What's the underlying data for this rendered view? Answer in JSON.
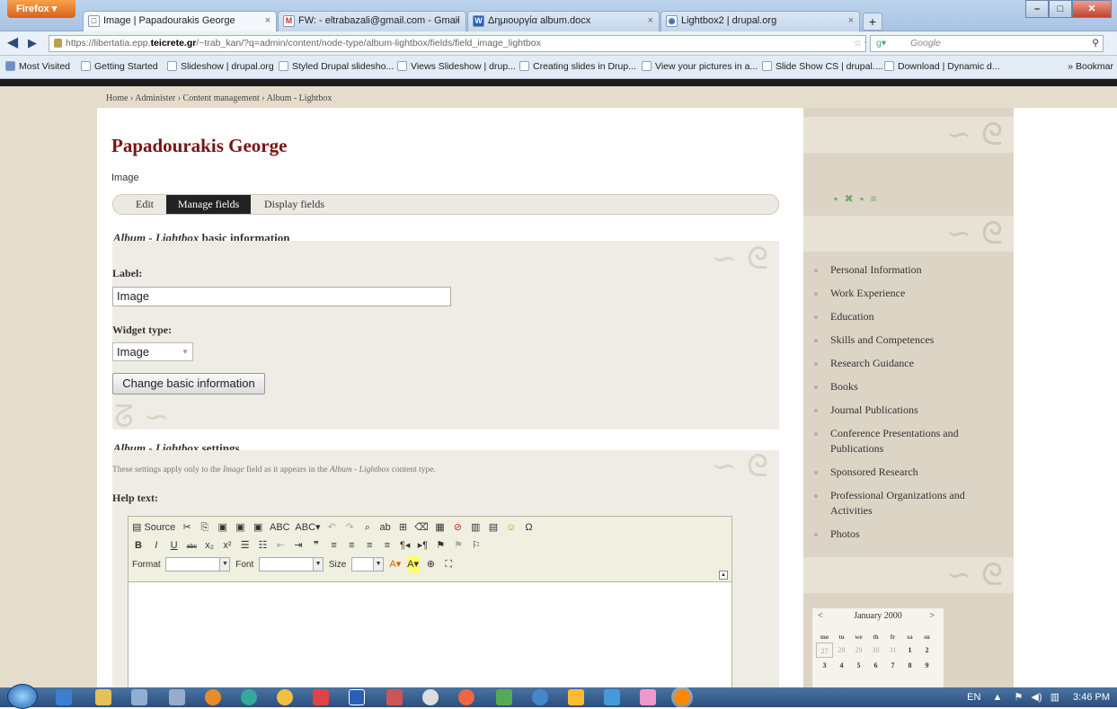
{
  "browser": {
    "menu_button": "Firefox",
    "tabs": [
      {
        "label": "Image | Papadourakis George",
        "icon": "□",
        "close": "×"
      },
      {
        "label": "FW: - eltrabazali@gmail.com - Gmail",
        "icon": "M",
        "close": "×"
      },
      {
        "label": "Δημιουργία album.docx",
        "icon": "W",
        "close": "×"
      },
      {
        "label": "Lightbox2 | drupal.org",
        "icon": "◉",
        "close": "×"
      }
    ],
    "new_tab": "+",
    "url_prefix": "https://libertatia.epp.",
    "url_domain": "teicrete.gr",
    "url_suffix": "/~trab_kan/?q=admin/content/node-type/album-lightbox/fields/field_image_lightbox",
    "search_placeholder": "Google",
    "bookmarks": [
      "Most Visited",
      "Getting Started",
      "Slideshow | drupal.org",
      "Styled Drupal slidesho...",
      "Views Slideshow | drup...",
      "Creating slides in Drup...",
      "View your pictures in a...",
      "Slide Show CS | drupal....",
      "Download | Dynamic d..."
    ],
    "bookmarks_overflow": "» Bookmar"
  },
  "page": {
    "breadcrumb": "Home › Administer › Content management › Album - Lightbox",
    "site_title": "Papadourakis George",
    "subtitle": "Image",
    "tabs": [
      "Edit",
      "Manage fields",
      "Display fields"
    ],
    "basic": {
      "legend_italic": "Album - Lightbox",
      "legend_rest": " basic information",
      "label_caption": "Label:",
      "label_value": "Image",
      "widget_caption": "Widget type:",
      "widget_value": "Image",
      "change_button": "Change basic information"
    },
    "settings": {
      "legend_italic": "Album - Lightbox",
      "legend_rest": " settings",
      "desc_pre": "These settings apply only to the ",
      "desc_field": "Image",
      "desc_mid": " field as it appears in the ",
      "desc_type": "Album - Lightbox",
      "desc_post": " content type.",
      "help_caption": "Help text:"
    },
    "editor": {
      "row1": [
        "▤ Source",
        "✂",
        "⎘",
        "▣",
        "▣",
        "▣",
        "ABC",
        "ABC▾",
        "↶",
        "↷",
        "⌕",
        "ab",
        "⊞",
        "⌫",
        "▦",
        "⊘",
        "▥",
        "▤",
        "☺",
        "Ω"
      ],
      "row2": [
        "B",
        "I",
        "U",
        "abc",
        "x₂",
        "x²",
        "☰",
        "☷",
        "⇤",
        "⇥",
        "❞",
        "≡",
        "≡",
        "≡",
        "≡",
        "¶◂",
        "▸¶",
        "⚑",
        "⚑",
        "⚐"
      ],
      "format_label": "Format",
      "font_label": "Font",
      "size_label": "Size",
      "row3_tail": [
        "A▾",
        "A▾",
        "⊕",
        "⛶"
      ]
    }
  },
  "sidebar": {
    "languages": "▪ ✖ ▪ ≡",
    "menu": [
      "Personal Information",
      "Work Experience",
      "Education",
      "Skills and Competences",
      "Research Guidance",
      "Books",
      "Journal Publications",
      "Conference Presentations and Publications",
      "Sponsored Research",
      "Professional Organizations and Activities",
      "Photos"
    ],
    "calendar": {
      "prev": "<",
      "next": ">",
      "month": "January 2000",
      "dow": [
        "mo",
        "tu",
        "we",
        "th",
        "fr",
        "sa",
        "su"
      ],
      "row1": [
        "27",
        "28",
        "29",
        "30",
        "31",
        "1",
        "2"
      ],
      "row2": [
        "3",
        "4",
        "5",
        "6",
        "7",
        "8",
        "9"
      ]
    }
  },
  "taskbar": {
    "lang": "EN",
    "time": "3:46 PM"
  }
}
